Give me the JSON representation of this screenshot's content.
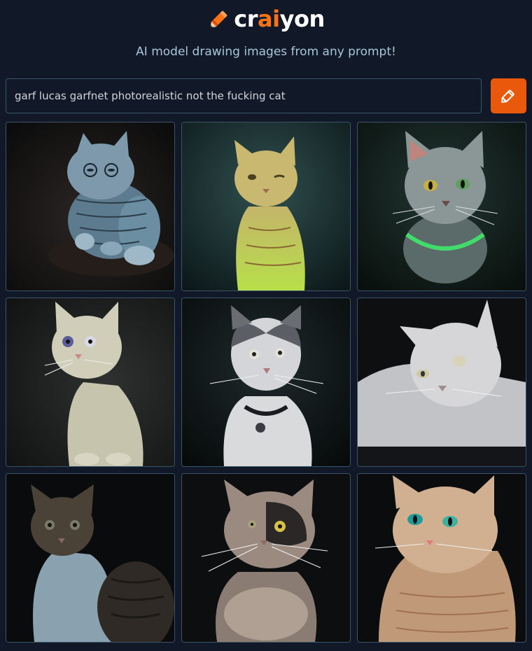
{
  "brand": {
    "name_pre": "cr",
    "name_accent": "ai",
    "name_post": "yon",
    "logo_icon": "pencil-icon",
    "accent_color": "#f97316"
  },
  "tagline": "AI model drawing images from any prompt!",
  "prompt": {
    "value": "garf lucas garfnet photorealistic not the fucking cat",
    "placeholder": ""
  },
  "draw_button": {
    "icon": "pencil-icon",
    "color": "#ea580c"
  },
  "results": [
    {
      "name": "result-image-1",
      "subject": "tabby-cat-blue-tint"
    },
    {
      "name": "result-image-2",
      "subject": "yellow-green-cat"
    },
    {
      "name": "result-image-3",
      "subject": "grey-cat-green-glow"
    },
    {
      "name": "result-image-4",
      "subject": "white-kitten"
    },
    {
      "name": "result-image-5",
      "subject": "white-grey-cat-collar"
    },
    {
      "name": "result-image-6",
      "subject": "white-cat-lying"
    },
    {
      "name": "result-image-7",
      "subject": "dark-tabby-cat"
    },
    {
      "name": "result-image-8",
      "subject": "fluffy-cat"
    },
    {
      "name": "result-image-9",
      "subject": "cream-cat-blue-eyes"
    }
  ]
}
